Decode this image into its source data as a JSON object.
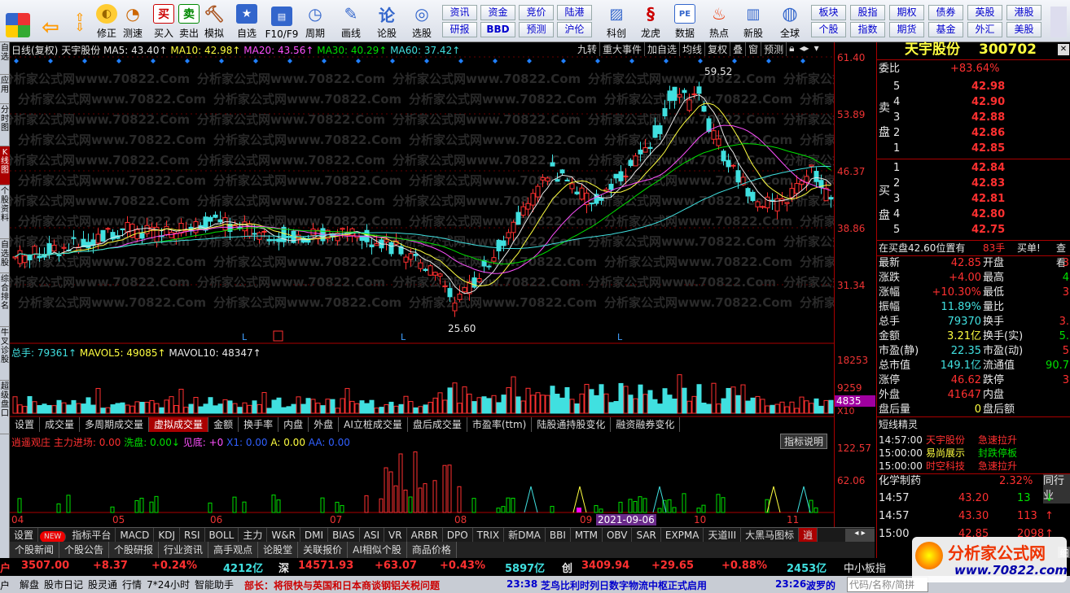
{
  "toolbar": {
    "buttons": [
      {
        "label": "",
        "icon": "windows-icon"
      },
      {
        "label": "",
        "icon": "back-arrow-icon"
      },
      {
        "label": "",
        "icon": "updown-arrows-icon"
      },
      {
        "label": "修正",
        "icon": "fix-icon"
      },
      {
        "label": "测速",
        "icon": "speed-icon"
      },
      {
        "label": "买入",
        "icon": "buy-icon",
        "glyph": "买"
      },
      {
        "label": "卖出",
        "icon": "sell-icon",
        "glyph": "卖"
      },
      {
        "label": "模拟",
        "icon": "hammer-icon"
      },
      {
        "label": "自选",
        "icon": "star-icon"
      },
      {
        "label": "F10/F9",
        "icon": "f10-icon"
      },
      {
        "label": "周期",
        "icon": "clock-icon"
      },
      {
        "label": "画线",
        "icon": "pen-icon"
      },
      {
        "label": "论股",
        "icon": "forum-icon",
        "glyph": "论"
      },
      {
        "label": "选股",
        "icon": "chart-select-icon"
      },
      {
        "label": "科创",
        "icon": "kechuang-icon"
      },
      {
        "label": "龙虎",
        "icon": "dragon-icon"
      },
      {
        "label": "数据",
        "icon": "pe-icon",
        "glyph": "PE"
      },
      {
        "label": "热点",
        "icon": "hot-icon"
      },
      {
        "label": "新股",
        "icon": "new-stock-icon"
      },
      {
        "label": "全球",
        "icon": "globe-icon"
      }
    ],
    "grid1": [
      [
        "资讯",
        "资金",
        "竞价",
        "陆港"
      ],
      [
        "研报",
        "BBD",
        "预测",
        "沪伦"
      ]
    ],
    "grid2": [
      [
        "板块",
        "股指",
        "期权",
        "债券",
        "期权",
        "港股"
      ],
      [
        "个股",
        "指数",
        "期货",
        "基金",
        "外汇",
        "美股"
      ]
    ],
    "grid2_labels": [
      [
        "板块",
        "股指",
        "期权",
        "债券",
        "英股",
        "港股"
      ],
      [
        "个股",
        "指数",
        "期货",
        "基金",
        "外汇",
        "美股"
      ]
    ]
  },
  "leftnav": [
    "自选",
    "应用",
    "分时图",
    "K线图",
    "个股资料",
    "自选股",
    "综合排名",
    "牛叉诊股",
    "超级盘口"
  ],
  "chart_header": {
    "title": "日线(复权)",
    "stock": "天宇股份",
    "ma5": "MA5: 43.40↑",
    "ma10": "MA10: 42.98↑",
    "ma20": "MA20: 43.56↑",
    "ma30": "MA30: 40.29↑",
    "ma60": "MA60: 37.42↑",
    "tools": [
      "九转",
      "重大事件",
      "加自选",
      "均线",
      "复权",
      "叠",
      "窗",
      "预测"
    ]
  },
  "chart_data": {
    "type": "candlestick",
    "price_axis": [
      "61.40",
      "53.89",
      "46.37",
      "38.86",
      "31.34"
    ],
    "high_label": "59.52",
    "low_label": "25.60",
    "vol_axis": [
      "18253",
      "9259"
    ],
    "vol_current": "4835",
    "vol_unit": "X10",
    "indicator_axis": [
      "122.57",
      "62.06"
    ],
    "months": [
      "04",
      "05",
      "06",
      "07",
      "08",
      "09",
      "10",
      "11"
    ],
    "date_marker": "2021-09-06"
  },
  "volume_header": {
    "total": "总手: 79361↑",
    "mavol5": "MAVOL5: 49085↑",
    "mavol10": "MAVOL10: 48347↑"
  },
  "indicator_tabs": [
    "设置",
    "成交量",
    "多周期成交量",
    "虚拟成交量",
    "金额",
    "换手率",
    "内盘",
    "外盘",
    "AI立桩成交量",
    "盘后成交量",
    "市盈率(ttm)",
    "陆股通持股变化",
    "融资融券变化"
  ],
  "indicator_header": {
    "name": "逍遥观庄",
    "main": "主力进场: 0.00",
    "wash": "洗盘: 0.00↓",
    "bottom": "见底: +0",
    "x1": "X1: 0.00",
    "a": "A: 0.00",
    "aa": "AA: 0.00",
    "help": "指标说明"
  },
  "bottom_tabs": [
    "设置",
    "NEW",
    "指标平台",
    "MACD",
    "KDJ",
    "RSI",
    "BOLL",
    "主力",
    "W&R",
    "DMI",
    "BIAS",
    "ASI",
    "VR",
    "ARBR",
    "DPO",
    "TRIX",
    "新DMA",
    "BBI",
    "MTM",
    "OBV",
    "SAR",
    "EXPMA",
    "天道III",
    "大黑马图标",
    "逍"
  ],
  "sec_tabs": [
    "个股新闻",
    "个股公告",
    "个股研报",
    "行业资讯",
    "高手观点",
    "论股堂",
    "关联报价",
    "AI相似个股",
    "商品价格"
  ],
  "quote": {
    "name": "天宇股份",
    "code": "300702",
    "weibi_label": "委比",
    "weibi": "+83.64%",
    "sell": [
      [
        "5",
        "42.98"
      ],
      [
        "4",
        "42.90"
      ],
      [
        "3",
        "42.88"
      ],
      [
        "2",
        "42.86"
      ],
      [
        "1",
        "42.85"
      ]
    ],
    "buy": [
      [
        "1",
        "42.84"
      ],
      [
        "2",
        "42.83"
      ],
      [
        "3",
        "42.81"
      ],
      [
        "4",
        "42.80"
      ],
      [
        "5",
        "42.75"
      ]
    ],
    "sell_label": [
      "卖",
      "盘"
    ],
    "buy_label": [
      "买",
      "盘"
    ],
    "notice": "在买盘42.60位置有",
    "notice_qty": "83手",
    "notice_type": "买单!",
    "notice_more": "查看",
    "stats": [
      [
        "最新",
        "42.85",
        "开盘",
        "3"
      ],
      [
        "涨跌",
        "+4.00",
        "最高",
        "4"
      ],
      [
        "涨幅",
        "+10.30%",
        "最低",
        "3"
      ],
      [
        "振幅",
        "11.89%",
        "量比",
        ""
      ],
      [
        "总手",
        "79370",
        "换手",
        "3."
      ],
      [
        "金额",
        "3.21亿",
        "换手(实)",
        "5."
      ],
      [
        "市盈(静)",
        "22.35",
        "市盈(动)",
        "5"
      ],
      [
        "总市值",
        "149.1亿",
        "流通值",
        "90.7"
      ],
      [
        "涨停",
        "46.62",
        "跌停",
        "3"
      ],
      [
        "外盘",
        "41647",
        "内盘",
        ""
      ],
      [
        "盘后量",
        "0",
        "盘后额",
        ""
      ]
    ],
    "short_label": "短线精灵",
    "short": [
      [
        "14:57:00",
        "天宇股份",
        "急速拉升"
      ],
      [
        "15:00:00",
        "易尚展示",
        "封跌停板"
      ],
      [
        "15:00:00",
        "时空科技",
        "急速拉升"
      ]
    ],
    "industry": "化学制药",
    "industry_pct": "2.32%",
    "industry_more": "同行业",
    "ticks": [
      [
        "14:57",
        "43.20",
        "13"
      ],
      [
        "14:57",
        "43.30",
        "113"
      ],
      [
        "15:00",
        "42.85",
        "2098"
      ]
    ],
    "tick_label": "细"
  },
  "ticker": {
    "sh_label": "户",
    "sh": "3507.00",
    "sh_chg": "+8.37",
    "sh_pct": "+0.24%",
    "sh_amt": "4212亿",
    "sz_label": "深",
    "sz": "14571.93",
    "sz_chg": "+63.07",
    "sz_pct": "+0.43%",
    "sz_amt": "5897亿",
    "cy_label": "创",
    "cy": "3409.94",
    "cy_chg": "+29.65",
    "cy_pct": "+0.88%",
    "cy_amt": "2453亿",
    "board": "中小板指"
  },
  "news": {
    "items": [
      "解盘",
      "股市日记",
      "股灵通",
      "行情",
      "7*24小时",
      "智能助手"
    ],
    "first": "户",
    "headline1": "部长：将很快与英国和日本商谈钢铝关税问题",
    "time2": "23:38",
    "headline2": "芝鸟比利时列日数字物流中枢正式启用",
    "time3": "23:26",
    "headline3": "波罗的",
    "tail": "代码/名称/简拼"
  },
  "watermark": {
    "site": "分析家公式网",
    "url": "www.70822.com",
    "wm": "分析家公式网www.70822.Com"
  }
}
